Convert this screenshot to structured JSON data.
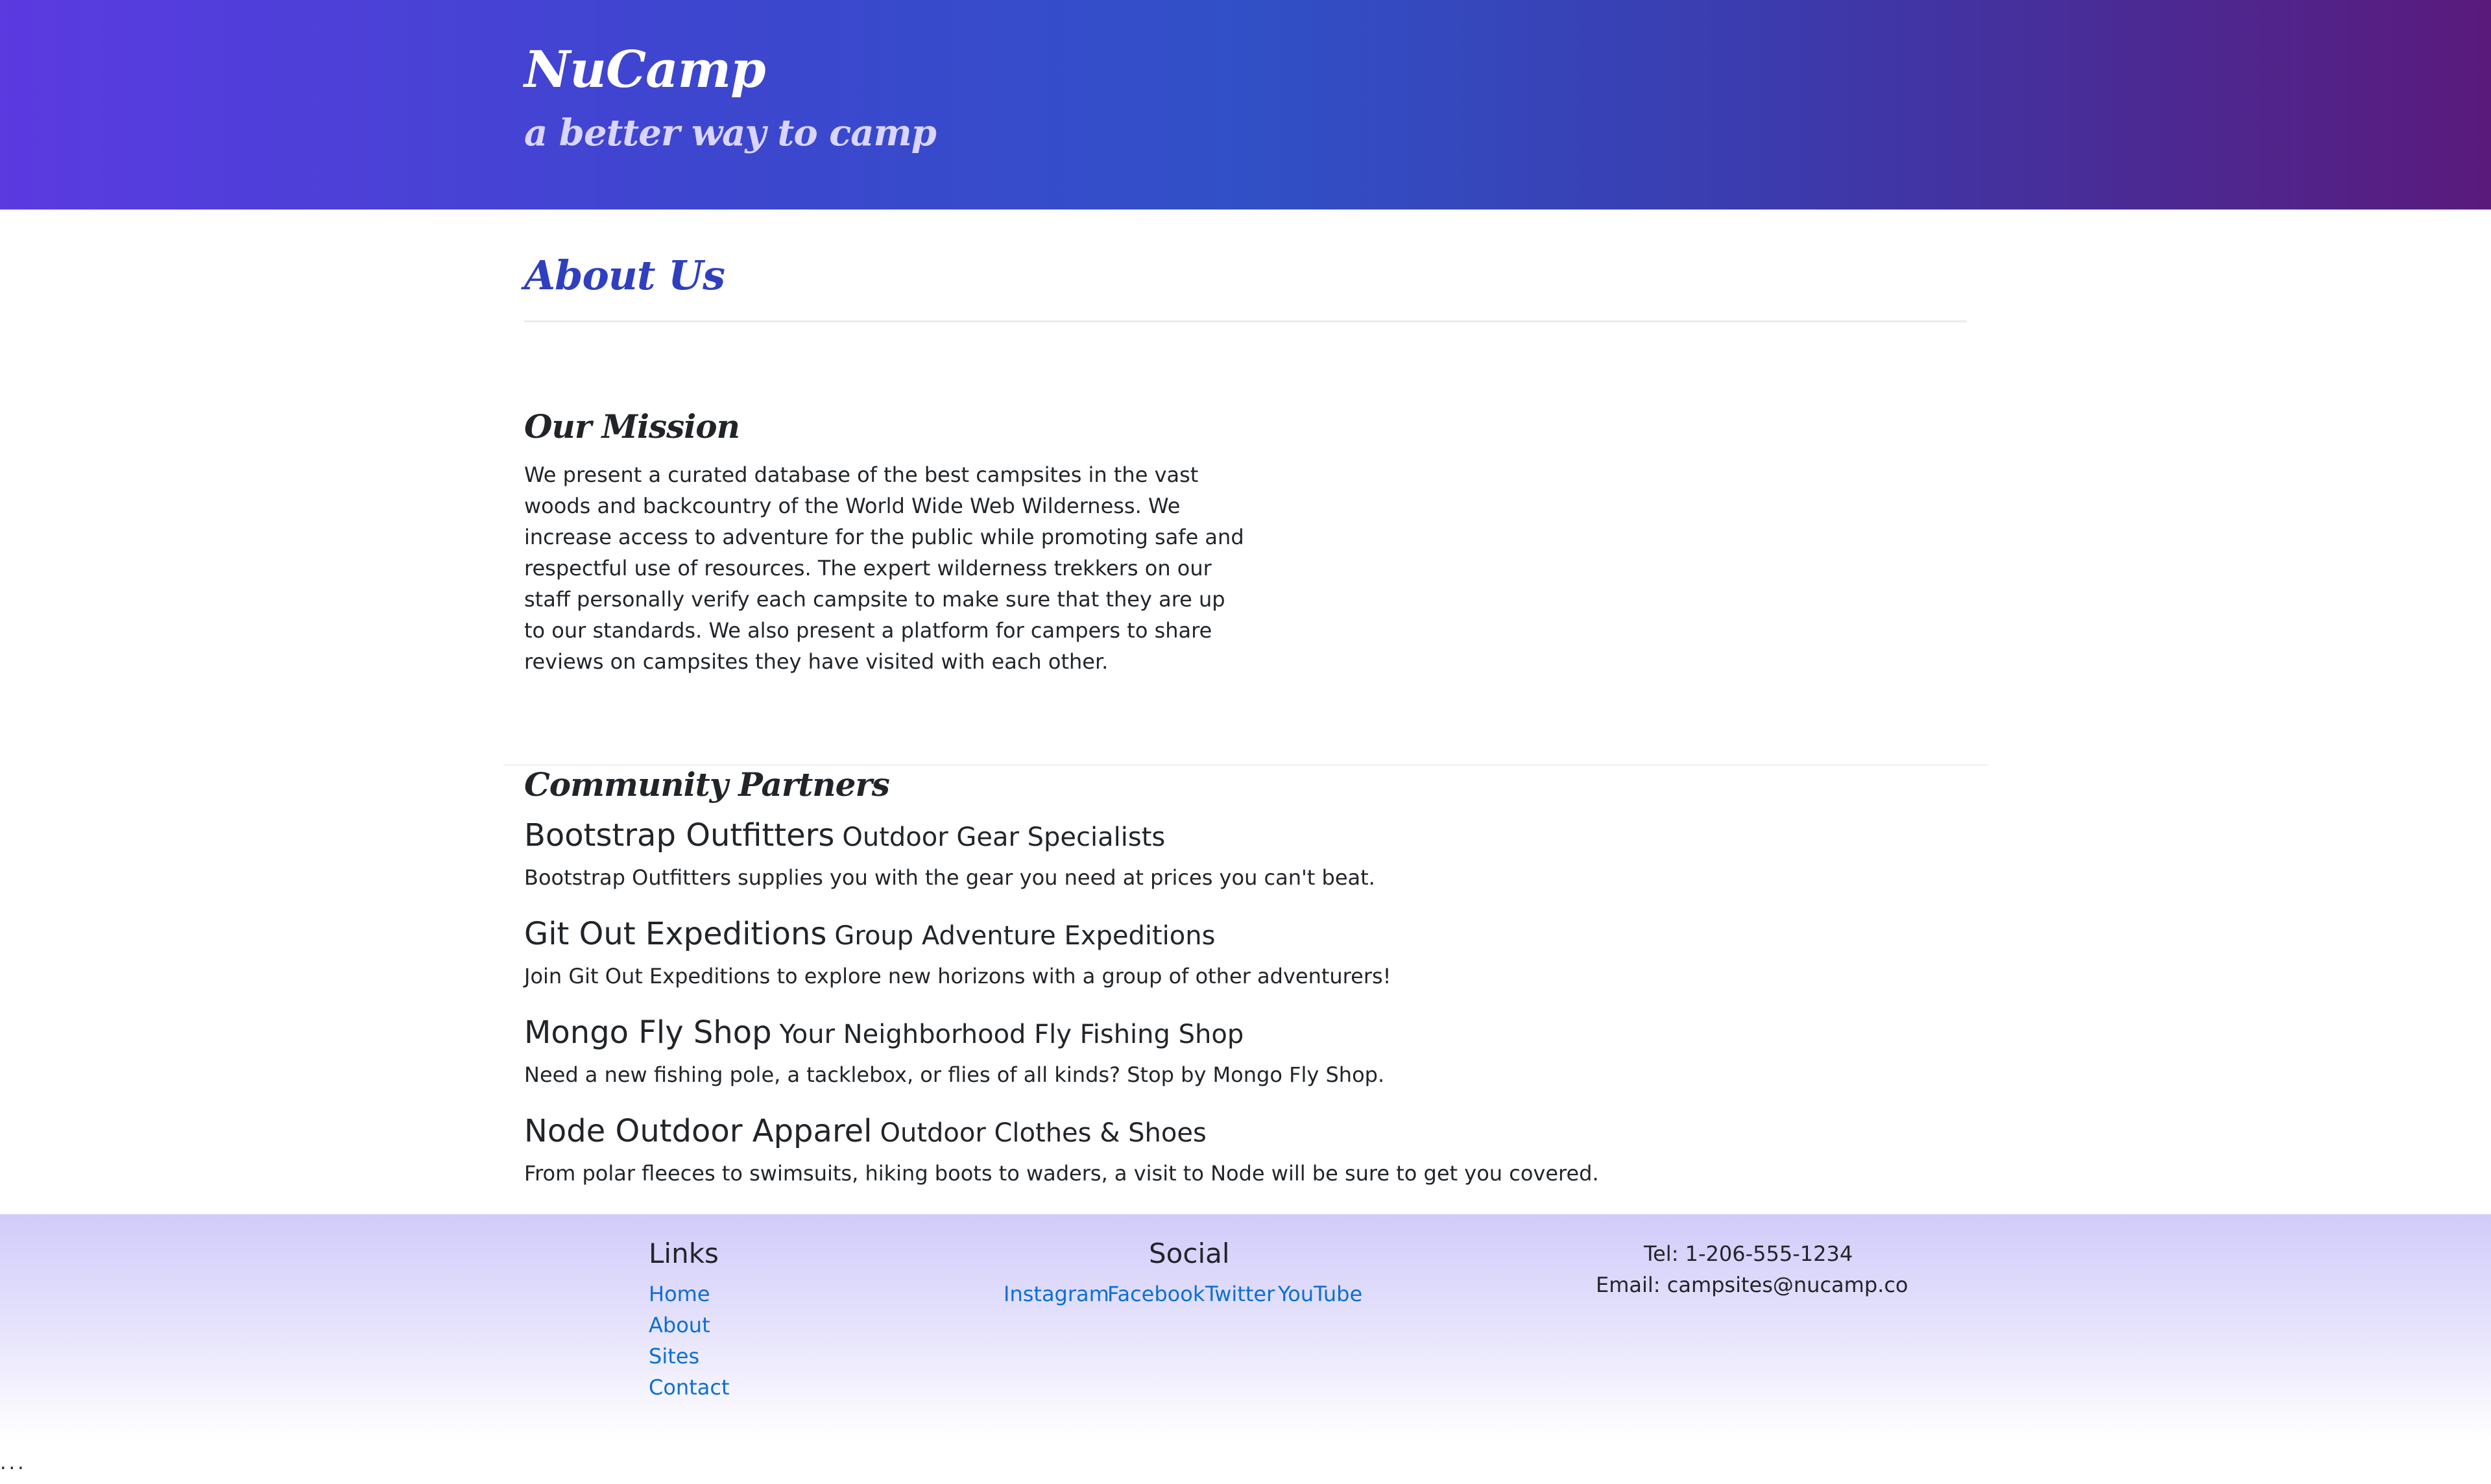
{
  "header": {
    "title": "NuCamp",
    "tagline": "a better way to camp"
  },
  "main": {
    "heading": "About Us",
    "mission": {
      "heading": "Our Mission",
      "text": "We present a curated database of the best campsites in the vast woods and backcountry of the World Wide Web Wilderness. We increase access to adventure for the public while promoting safe and respectful use of resources. The expert wilderness trekkers on our staff personally verify each campsite to make sure that they are up to our standards. We also present a platform for campers to share reviews on campsites they have visited with each other."
    },
    "partners": {
      "heading": "Community Partners",
      "items": [
        {
          "name": "Bootstrap Outfitters",
          "tagline": "Outdoor Gear Specialists",
          "description": "Bootstrap Outfitters supplies you with the gear you need at prices you can't beat."
        },
        {
          "name": "Git Out Expeditions",
          "tagline": "Group Adventure Expeditions",
          "description": "Join Git Out Expeditions to explore new horizons with a group of other adventurers!"
        },
        {
          "name": "Mongo Fly Shop",
          "tagline": "Your Neighborhood Fly Fishing Shop",
          "description": "Need a new fishing pole, a tacklebox, or flies of all kinds? Stop by Mongo Fly Shop."
        },
        {
          "name": "Node Outdoor Apparel",
          "tagline": "Outdoor Clothes & Shoes",
          "description": "From polar fleeces to swimsuits, hiking boots to waders, a visit to Node will be sure to get you covered."
        }
      ]
    }
  },
  "footer": {
    "links": {
      "heading": "Links",
      "items": [
        "Home",
        "About",
        "Sites",
        "Contact"
      ]
    },
    "social": {
      "heading": "Social",
      "items": [
        "Instagram",
        "Facebook",
        "Twitter",
        "YouTube"
      ]
    },
    "contact": {
      "tel": "Tel: 1-206-555-1234",
      "email": "Email: campsites@nucamp.co"
    }
  },
  "trailing": "..."
}
